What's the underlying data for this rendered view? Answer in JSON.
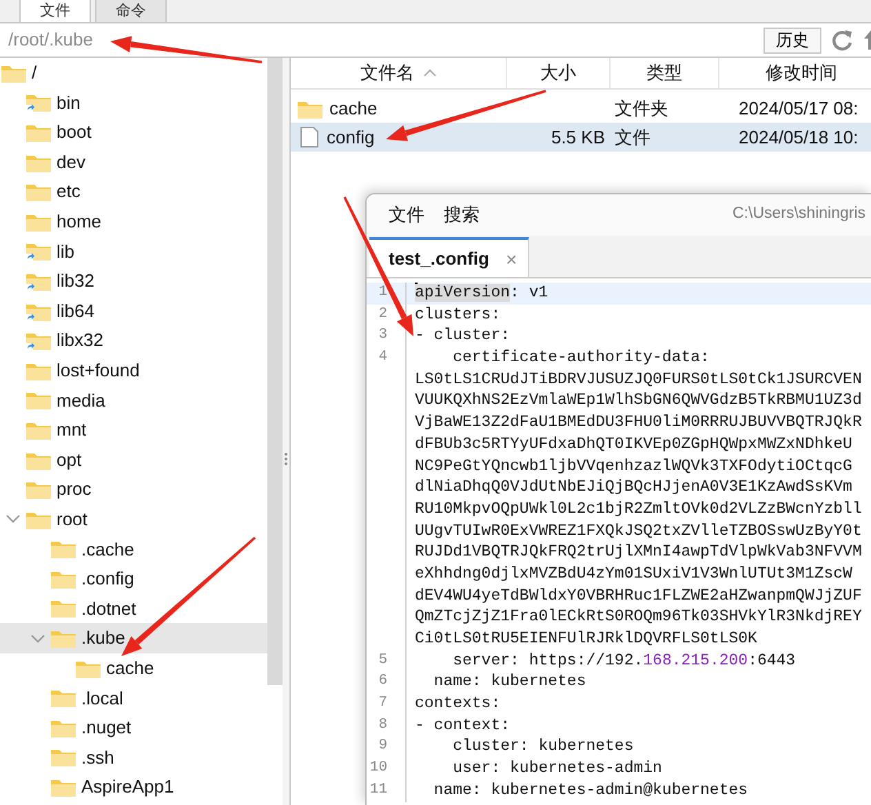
{
  "top_tabs": [
    {
      "label": "文件",
      "selected": true
    },
    {
      "label": "命令",
      "selected": false
    }
  ],
  "path_bar": {
    "value": "/root/.kube",
    "history_button": "历史"
  },
  "tree": [
    {
      "label": "/",
      "kind": "folder",
      "selected": false,
      "children": [
        {
          "label": "bin",
          "kind": "symlink",
          "selected": false
        },
        {
          "label": "boot",
          "kind": "folder",
          "selected": false
        },
        {
          "label": "dev",
          "kind": "folder",
          "selected": false
        },
        {
          "label": "etc",
          "kind": "folder",
          "selected": false
        },
        {
          "label": "home",
          "kind": "folder",
          "selected": false
        },
        {
          "label": "lib",
          "kind": "symlink",
          "selected": false
        },
        {
          "label": "lib32",
          "kind": "symlink",
          "selected": false
        },
        {
          "label": "lib64",
          "kind": "symlink",
          "selected": false
        },
        {
          "label": "libx32",
          "kind": "symlink",
          "selected": false
        },
        {
          "label": "lost+found",
          "kind": "folder",
          "selected": false
        },
        {
          "label": "media",
          "kind": "folder",
          "selected": false
        },
        {
          "label": "mnt",
          "kind": "folder",
          "selected": false
        },
        {
          "label": "opt",
          "kind": "folder",
          "selected": false
        },
        {
          "label": "proc",
          "kind": "folder",
          "selected": false
        },
        {
          "label": "root",
          "kind": "folder",
          "selected": false,
          "expanded": true,
          "children": [
            {
              "label": ".cache",
              "kind": "folder",
              "selected": false
            },
            {
              "label": ".config",
              "kind": "folder",
              "selected": false
            },
            {
              "label": ".dotnet",
              "kind": "folder",
              "selected": false
            },
            {
              "label": ".kube",
              "kind": "folder",
              "selected": true,
              "expanded": true,
              "children": [
                {
                  "label": "cache",
                  "kind": "folder",
                  "selected": false
                }
              ]
            },
            {
              "label": ".local",
              "kind": "folder",
              "selected": false
            },
            {
              "label": ".nuget",
              "kind": "folder",
              "selected": false
            },
            {
              "label": ".ssh",
              "kind": "folder",
              "selected": false
            },
            {
              "label": "AspireApp1",
              "kind": "folder",
              "selected": false
            }
          ]
        }
      ]
    }
  ],
  "file_list": {
    "columns": [
      {
        "label": "文件名",
        "sorted": true
      },
      {
        "label": "大小",
        "sorted": false
      },
      {
        "label": "类型",
        "sorted": false
      },
      {
        "label": "修改时间",
        "sorted": false
      }
    ],
    "rows": [
      {
        "name": "cache",
        "kind": "folder",
        "type": "文件夹",
        "modified": "2024/05/17 08:",
        "selected": false
      },
      {
        "name": "config",
        "kind": "file",
        "size": "5.5 KB",
        "type": "文件",
        "modified": "2024/05/18 10:",
        "selected": true
      }
    ]
  },
  "editor": {
    "menu": [
      "文件",
      "搜索"
    ],
    "path": "C:\\Users\\shiningris",
    "tabs": [
      {
        "label": "test_.config",
        "selected": true,
        "close": "×"
      }
    ],
    "lines": [
      {
        "number": "1",
        "current": true,
        "segments": [
          {
            "text": "apiVersion",
            "kind": "match"
          },
          {
            "text": ": v1"
          }
        ]
      },
      {
        "number": "2",
        "current": false,
        "segments": [
          {
            "text": "clusters:"
          }
        ]
      },
      {
        "number": "3",
        "current": false,
        "segments": [
          {
            "text": "- cluster:"
          }
        ]
      },
      {
        "number": "4",
        "current": false,
        "segments": [
          {
            "text": "    certificate-authority-data:"
          }
        ]
      },
      {
        "current": false,
        "segments": [
          {
            "text": "LS0tLS1CRUdJTiBDRVJUSUZJQ0FURS0tLS0tCk1JSURCVEN"
          }
        ]
      },
      {
        "current": false,
        "segments": [
          {
            "text": "VUUKQXhNS2EzVmlaWEp1WlhSbGN6QWVGdzB5TkRBMU1UZ3d"
          }
        ]
      },
      {
        "current": false,
        "segments": [
          {
            "text": "VjBaWE13Z2dFaU1BMEdDU3FHU0liM0RRRUJBUVVBQTRJQkR"
          }
        ]
      },
      {
        "current": false,
        "segments": [
          {
            "text": "dFBUb3c5RTYyUFdxaDhQT0IKVEp0ZGpHQWpxMWZxNDhkeU"
          }
        ]
      },
      {
        "current": false,
        "segments": [
          {
            "text": "NC9PeGtYQncwb1ljbVVqenhzazlWQVk3TXFOdytiOCtqcG"
          }
        ]
      },
      {
        "current": false,
        "segments": [
          {
            "text": "dlNiaDhqQ0VJdUtNbEJiQjBQcHJjenA0V3E1KzAwdSsKVm"
          }
        ]
      },
      {
        "current": false,
        "segments": [
          {
            "text": "RU10MkpvOQpUWkl0L2c1bjR2ZmltOVk0d2VLZzBWcnYzbll"
          }
        ]
      },
      {
        "current": false,
        "segments": [
          {
            "text": "UUgvTUIwR0ExVWREZ1FXQkJSQ2txZVlleTZBOSswUzByY0t"
          }
        ]
      },
      {
        "current": false,
        "segments": [
          {
            "text": "RUJDd1VBQTRJQkFRQ2trUjlXMnI4awpTdVlpWkVab3NFVVM"
          }
        ]
      },
      {
        "current": false,
        "segments": [
          {
            "text": "eXhhdng0djlxMVZBdU4zYm01SUxiV1V3WnlUTUt3M1ZscW"
          }
        ]
      },
      {
        "current": false,
        "segments": [
          {
            "text": "dEV4WU4yeTdBWldxY0VBRHRuc1FLZWE2aHZwanpmQWJjZUF"
          }
        ]
      },
      {
        "current": false,
        "segments": [
          {
            "text": "QmZTcjZjZ1Fra0lECkRtS0ROQm96Tk03SHVkYlR3NkdjREY"
          }
        ]
      },
      {
        "current": false,
        "segments": [
          {
            "text": "Ci0tLS0tRU5EIENFUlRJRklDQVRFLS0tLS0K"
          }
        ]
      },
      {
        "number": "5",
        "current": false,
        "segments": [
          {
            "text": "    server: https://192."
          },
          {
            "text": "168.215.200",
            "kind": "number"
          },
          {
            "text": ":6443"
          }
        ]
      },
      {
        "number": "6",
        "current": false,
        "segments": [
          {
            "text": "  name: kubernetes"
          }
        ]
      },
      {
        "number": "7",
        "current": false,
        "segments": [
          {
            "text": "contexts:"
          }
        ]
      },
      {
        "number": "8",
        "current": false,
        "segments": [
          {
            "text": "- context:"
          }
        ]
      },
      {
        "number": "9",
        "current": false,
        "segments": [
          {
            "text": "    cluster: kubernetes"
          }
        ]
      },
      {
        "number": "10",
        "current": false,
        "segments": [
          {
            "text": "    user: kubernetes-admin"
          }
        ]
      },
      {
        "number": "11",
        "current": false,
        "segments": [
          {
            "text": "  name: kubernetes-admin@kubernetes"
          }
        ]
      }
    ]
  }
}
